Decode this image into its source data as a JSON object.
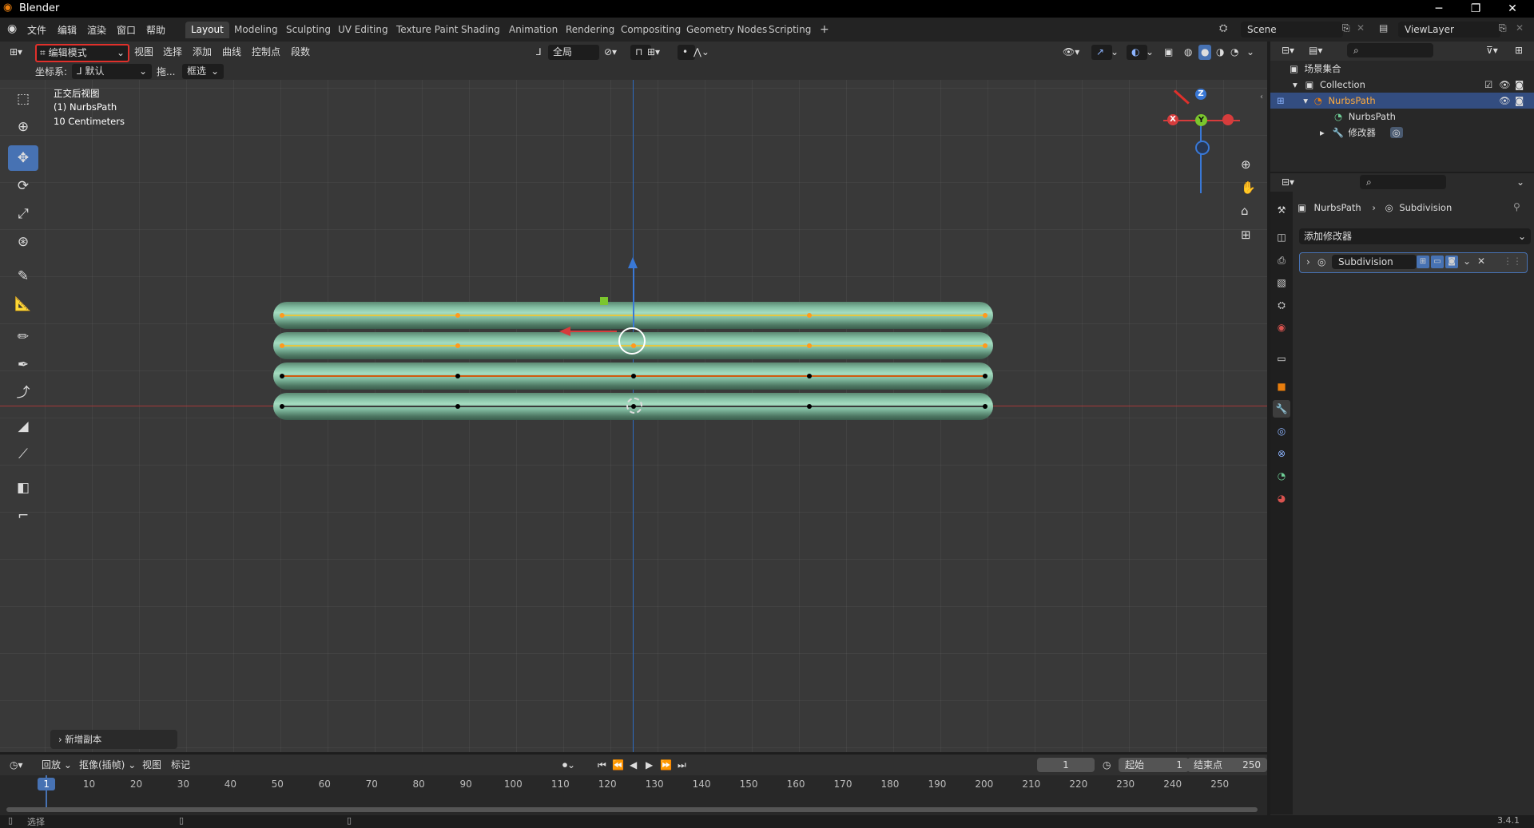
{
  "app": {
    "title": "Blender",
    "version": "3.4.1"
  },
  "menu": [
    "文件",
    "编辑",
    "渲染",
    "窗口",
    "帮助"
  ],
  "workspaces": [
    "Layout",
    "Modeling",
    "Sculpting",
    "UV Editing",
    "Texture Paint",
    "Shading",
    "Animation",
    "Rendering",
    "Compositing",
    "Geometry Nodes",
    "Scripting"
  ],
  "workspace_add": "+",
  "scene": {
    "name": "Scene",
    "view_layer": "ViewLayer"
  },
  "viewport_header": {
    "mode": "编辑模式",
    "menus": [
      "视图",
      "选择",
      "添加",
      "曲线",
      "控制点",
      "段数"
    ],
    "orientation": "全局"
  },
  "tool_settings": {
    "coord_label": "坐标系:",
    "coord_value": "默认",
    "drag_label": "拖...",
    "drag_value": "框选"
  },
  "viewport_overlay": {
    "view_name": "正交后视图",
    "object": "(1) NurbsPath",
    "scale": "10 Centimeters"
  },
  "gizmo": {
    "x": "X",
    "y": "Y",
    "z": "Z"
  },
  "redo_panel": "新增副本",
  "outliner": {
    "root": "场景集合",
    "collection": "Collection",
    "object": "NurbsPath",
    "data": "NurbsPath",
    "modifiers": "修改器"
  },
  "properties": {
    "breadcrumb_object": "NurbsPath",
    "breadcrumb_modifier": "Subdivision",
    "add_modifier": "添加修改器",
    "modifier_name": "Subdivision"
  },
  "timeline": {
    "menus": [
      "回放",
      "抠像(插帧)",
      "视图",
      "标记"
    ],
    "current_frame": "1",
    "start_label": "起始",
    "start": "1",
    "end_label": "结束点",
    "end": "250",
    "ticks": [
      "1",
      "10",
      "20",
      "30",
      "40",
      "50",
      "60",
      "70",
      "80",
      "90",
      "100",
      "110",
      "120",
      "130",
      "140",
      "150",
      "160",
      "170",
      "180",
      "190",
      "200",
      "210",
      "220",
      "230",
      "240",
      "250"
    ]
  },
  "status": {
    "select": "选择"
  },
  "colors": {
    "accent": "#4772b3",
    "orange": "#e87d0d",
    "tube": "#86c2a6",
    "selected_cp": "#ff9a1f",
    "axis_x": "#d63c3c",
    "axis_y": "#7bc62d",
    "axis_z": "#3978d6"
  }
}
